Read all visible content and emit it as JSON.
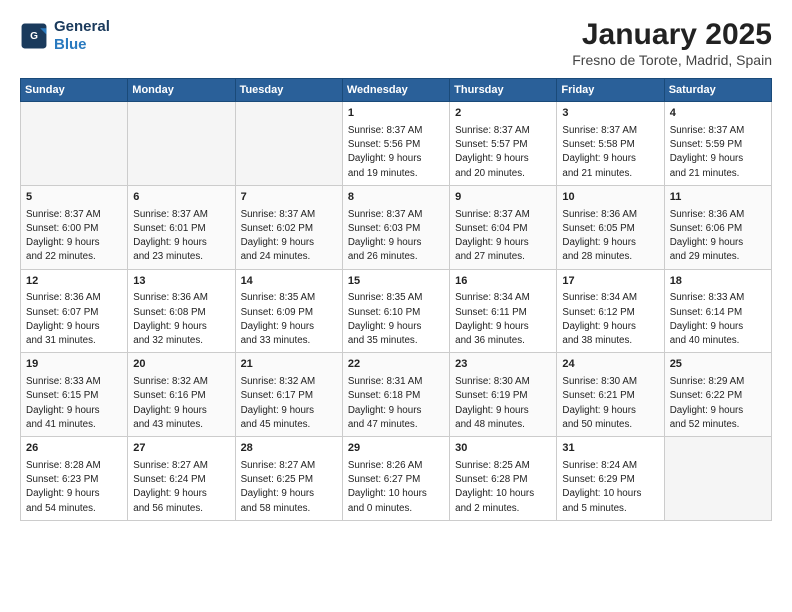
{
  "header": {
    "logo_line1": "General",
    "logo_line2": "Blue",
    "month": "January 2025",
    "location": "Fresno de Torote, Madrid, Spain"
  },
  "weekdays": [
    "Sunday",
    "Monday",
    "Tuesday",
    "Wednesday",
    "Thursday",
    "Friday",
    "Saturday"
  ],
  "weeks": [
    [
      {
        "day": "",
        "content": ""
      },
      {
        "day": "",
        "content": ""
      },
      {
        "day": "",
        "content": ""
      },
      {
        "day": "1",
        "content": "Sunrise: 8:37 AM\nSunset: 5:56 PM\nDaylight: 9 hours\nand 19 minutes."
      },
      {
        "day": "2",
        "content": "Sunrise: 8:37 AM\nSunset: 5:57 PM\nDaylight: 9 hours\nand 20 minutes."
      },
      {
        "day": "3",
        "content": "Sunrise: 8:37 AM\nSunset: 5:58 PM\nDaylight: 9 hours\nand 21 minutes."
      },
      {
        "day": "4",
        "content": "Sunrise: 8:37 AM\nSunset: 5:59 PM\nDaylight: 9 hours\nand 21 minutes."
      }
    ],
    [
      {
        "day": "5",
        "content": "Sunrise: 8:37 AM\nSunset: 6:00 PM\nDaylight: 9 hours\nand 22 minutes."
      },
      {
        "day": "6",
        "content": "Sunrise: 8:37 AM\nSunset: 6:01 PM\nDaylight: 9 hours\nand 23 minutes."
      },
      {
        "day": "7",
        "content": "Sunrise: 8:37 AM\nSunset: 6:02 PM\nDaylight: 9 hours\nand 24 minutes."
      },
      {
        "day": "8",
        "content": "Sunrise: 8:37 AM\nSunset: 6:03 PM\nDaylight: 9 hours\nand 26 minutes."
      },
      {
        "day": "9",
        "content": "Sunrise: 8:37 AM\nSunset: 6:04 PM\nDaylight: 9 hours\nand 27 minutes."
      },
      {
        "day": "10",
        "content": "Sunrise: 8:36 AM\nSunset: 6:05 PM\nDaylight: 9 hours\nand 28 minutes."
      },
      {
        "day": "11",
        "content": "Sunrise: 8:36 AM\nSunset: 6:06 PM\nDaylight: 9 hours\nand 29 minutes."
      }
    ],
    [
      {
        "day": "12",
        "content": "Sunrise: 8:36 AM\nSunset: 6:07 PM\nDaylight: 9 hours\nand 31 minutes."
      },
      {
        "day": "13",
        "content": "Sunrise: 8:36 AM\nSunset: 6:08 PM\nDaylight: 9 hours\nand 32 minutes."
      },
      {
        "day": "14",
        "content": "Sunrise: 8:35 AM\nSunset: 6:09 PM\nDaylight: 9 hours\nand 33 minutes."
      },
      {
        "day": "15",
        "content": "Sunrise: 8:35 AM\nSunset: 6:10 PM\nDaylight: 9 hours\nand 35 minutes."
      },
      {
        "day": "16",
        "content": "Sunrise: 8:34 AM\nSunset: 6:11 PM\nDaylight: 9 hours\nand 36 minutes."
      },
      {
        "day": "17",
        "content": "Sunrise: 8:34 AM\nSunset: 6:12 PM\nDaylight: 9 hours\nand 38 minutes."
      },
      {
        "day": "18",
        "content": "Sunrise: 8:33 AM\nSunset: 6:14 PM\nDaylight: 9 hours\nand 40 minutes."
      }
    ],
    [
      {
        "day": "19",
        "content": "Sunrise: 8:33 AM\nSunset: 6:15 PM\nDaylight: 9 hours\nand 41 minutes."
      },
      {
        "day": "20",
        "content": "Sunrise: 8:32 AM\nSunset: 6:16 PM\nDaylight: 9 hours\nand 43 minutes."
      },
      {
        "day": "21",
        "content": "Sunrise: 8:32 AM\nSunset: 6:17 PM\nDaylight: 9 hours\nand 45 minutes."
      },
      {
        "day": "22",
        "content": "Sunrise: 8:31 AM\nSunset: 6:18 PM\nDaylight: 9 hours\nand 47 minutes."
      },
      {
        "day": "23",
        "content": "Sunrise: 8:30 AM\nSunset: 6:19 PM\nDaylight: 9 hours\nand 48 minutes."
      },
      {
        "day": "24",
        "content": "Sunrise: 8:30 AM\nSunset: 6:21 PM\nDaylight: 9 hours\nand 50 minutes."
      },
      {
        "day": "25",
        "content": "Sunrise: 8:29 AM\nSunset: 6:22 PM\nDaylight: 9 hours\nand 52 minutes."
      }
    ],
    [
      {
        "day": "26",
        "content": "Sunrise: 8:28 AM\nSunset: 6:23 PM\nDaylight: 9 hours\nand 54 minutes."
      },
      {
        "day": "27",
        "content": "Sunrise: 8:27 AM\nSunset: 6:24 PM\nDaylight: 9 hours\nand 56 minutes."
      },
      {
        "day": "28",
        "content": "Sunrise: 8:27 AM\nSunset: 6:25 PM\nDaylight: 9 hours\nand 58 minutes."
      },
      {
        "day": "29",
        "content": "Sunrise: 8:26 AM\nSunset: 6:27 PM\nDaylight: 10 hours\nand 0 minutes."
      },
      {
        "day": "30",
        "content": "Sunrise: 8:25 AM\nSunset: 6:28 PM\nDaylight: 10 hours\nand 2 minutes."
      },
      {
        "day": "31",
        "content": "Sunrise: 8:24 AM\nSunset: 6:29 PM\nDaylight: 10 hours\nand 5 minutes."
      },
      {
        "day": "",
        "content": ""
      }
    ]
  ]
}
